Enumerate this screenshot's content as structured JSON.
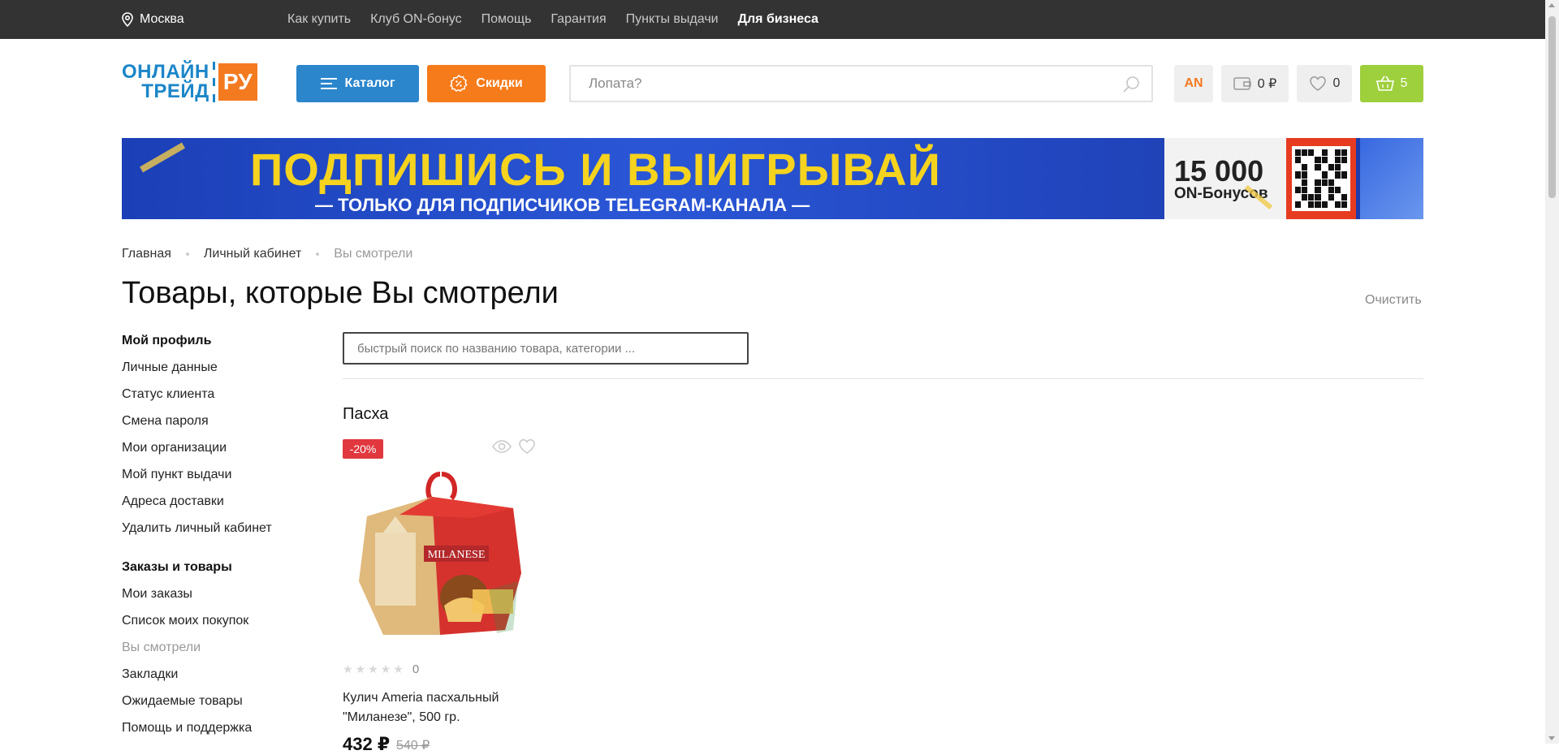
{
  "topbar": {
    "city": "Москва",
    "links": [
      "Как купить",
      "Клуб ON-бонус",
      "Помощь",
      "Гарантия",
      "Пункты выдачи"
    ],
    "business": "Для бизнеса"
  },
  "logo": {
    "line1": "ОНЛАЙН",
    "line2": "ТРЕЙД",
    "suffix": "РУ"
  },
  "header": {
    "catalog_label": "Каталог",
    "sale_label": "Скидки",
    "search_placeholder": "Лопата?",
    "user_initials": "AN",
    "wallet": "0 ₽",
    "favorites_count": "0",
    "cart_count": "5"
  },
  "banner": {
    "headline": "ПОДПИШИСЬ И ВЫИГРЫВАЙ",
    "subline": "— ТОЛЬКО ДЛЯ ПОДПИСЧИКОВ TELEGRAM-КАНАЛА —",
    "bonus_amount": "15 000",
    "bonus_label": "ON-Бонусов"
  },
  "breadcrumb": {
    "home": "Главная",
    "account": "Личный кабинет",
    "current": "Вы смотрели"
  },
  "page": {
    "title": "Товары, которые Вы смотрели",
    "clear_label": "Очистить"
  },
  "sidebar": {
    "profile_head": "Мой профиль",
    "profile_items": [
      "Личные данные",
      "Статус клиента",
      "Смена пароля",
      "Мои организации",
      "Мой пункт выдачи",
      "Адреса доставки",
      "Удалить личный кабинет"
    ],
    "orders_head": "Заказы и товары",
    "orders_items": [
      "Мои заказы",
      "Список моих покупок",
      "Вы смотрели",
      "Закладки",
      "Ожидаемые товары",
      "Помощь и поддержка"
    ]
  },
  "main": {
    "quick_search_placeholder": "быстрый поиск по названию товара, категории ...",
    "category": "Пасха",
    "product": {
      "discount": "-20%",
      "rating_count": "0",
      "name": "Кулич Ameria пасхальный \"Миланезе\", 500 гр.",
      "price": "432 ₽",
      "old_price": "540 ₽",
      "box_label": "MILANESE",
      "rating": 0
    }
  },
  "colors": {
    "accent_blue": "#2b86cc",
    "accent_orange": "#f67b1a",
    "cart_green": "#9ecf3c",
    "discount_red": "#e0383e"
  }
}
